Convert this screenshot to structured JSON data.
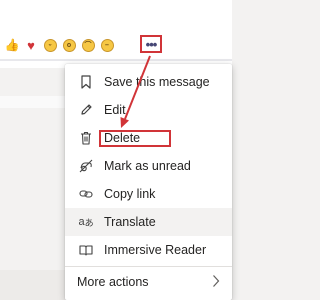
{
  "reactions": [
    {
      "name": "like",
      "glyph": "👍"
    },
    {
      "name": "heart",
      "glyph": "♥"
    },
    {
      "name": "laugh",
      "glyph": "😄"
    },
    {
      "name": "surprised",
      "glyph": "😮"
    },
    {
      "name": "sad",
      "glyph": "🙁"
    },
    {
      "name": "angry",
      "glyph": "😠"
    }
  ],
  "more_options": {
    "glyph": "•••"
  },
  "menu": {
    "items": [
      {
        "label": "Save this message",
        "icon": "bookmark-icon"
      },
      {
        "label": "Edit",
        "icon": "pencil-icon"
      },
      {
        "label": "Delete",
        "icon": "trash-icon"
      },
      {
        "label": "Mark as unread",
        "icon": "unread-icon"
      },
      {
        "label": "Copy link",
        "icon": "link-icon"
      },
      {
        "label": "Translate",
        "icon": "translate-icon"
      },
      {
        "label": "Immersive Reader",
        "icon": "reader-icon"
      }
    ],
    "more_actions": {
      "label": "More actions",
      "icon": "chevron-right-icon"
    }
  },
  "colors": {
    "annotation_red": "#d13438",
    "accent_purple": "#464775",
    "menu_background": "#ffffff",
    "page_background": "#f3f2f1"
  }
}
